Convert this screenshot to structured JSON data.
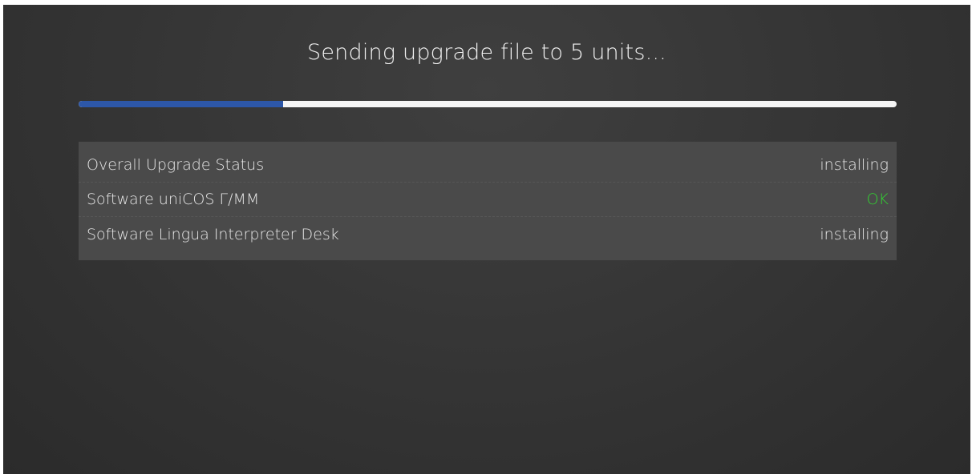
{
  "dialog": {
    "title": "Sending upgrade file to 5 units...",
    "progress": {
      "fraction": 0.25,
      "fill_color": "#2d57a8",
      "track_color": "#f5f5f5"
    }
  },
  "status": {
    "rows": [
      {
        "label": "Overall Upgrade Status",
        "value": "installing",
        "state": "normal"
      },
      {
        "label": "Software uniCOS Г/MM",
        "value": "OK",
        "state": "ok"
      },
      {
        "label": "Software Lingua Interpreter Desk",
        "value": "installing",
        "state": "normal"
      }
    ],
    "ok_color": "#32d232"
  }
}
